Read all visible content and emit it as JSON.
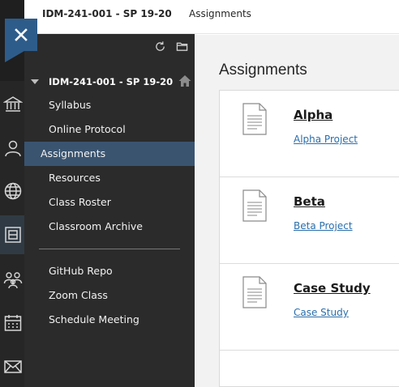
{
  "header": {
    "course": "IDM-241-001 - SP 19-20",
    "page": "Assignments"
  },
  "global_nav": {
    "icons": [
      "institution-icon",
      "user-icon",
      "globe-icon",
      "courses-icon",
      "groups-icon",
      "calendar-icon",
      "messages-icon"
    ]
  },
  "course_menu": {
    "heading": "IDM-241-001 - SP 19-20",
    "items": [
      {
        "label": "Syllabus"
      },
      {
        "label": "Online Protocol"
      },
      {
        "label": "Assignments"
      },
      {
        "label": "Resources"
      },
      {
        "label": "Class Roster"
      },
      {
        "label": "Classroom Archive"
      },
      {
        "label": "GitHub Repo"
      },
      {
        "label": "Zoom Class"
      },
      {
        "label": "Schedule Meeting"
      }
    ],
    "selected_item": "Assignments",
    "accent_color": "#3a5470"
  },
  "main": {
    "title": "Assignments",
    "items": [
      {
        "title": "Alpha",
        "link": "Alpha Project"
      },
      {
        "title": "Beta",
        "link": "Beta Project"
      },
      {
        "title": "Case Study",
        "link": "Case Study"
      }
    ]
  },
  "colors": {
    "close_button": "#2e5c8a",
    "link": "#2a6eab",
    "menu_bg": "#2b2b2b"
  }
}
